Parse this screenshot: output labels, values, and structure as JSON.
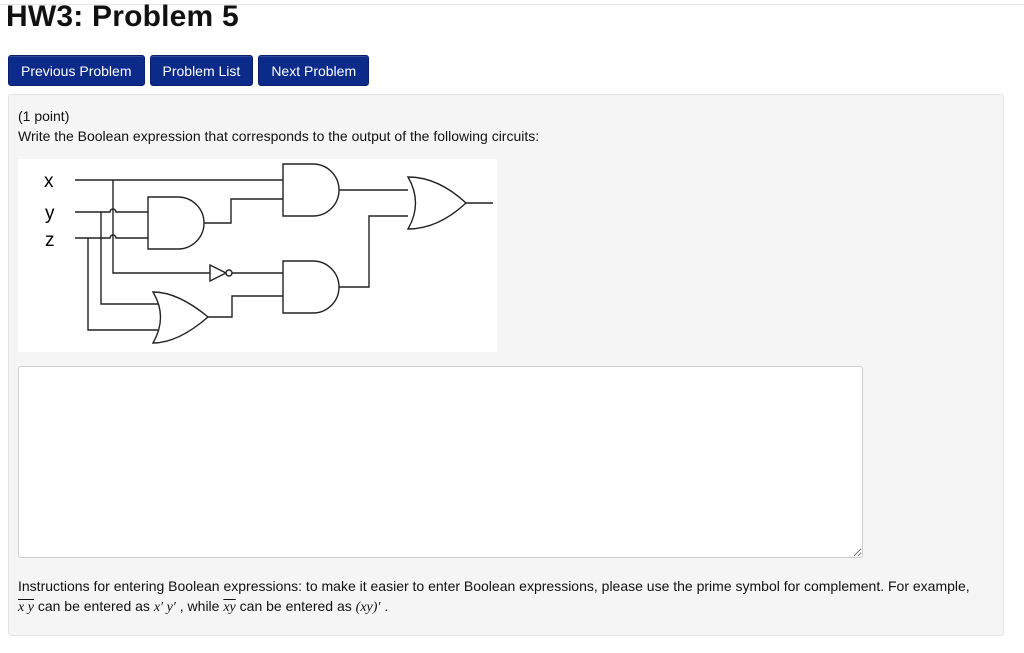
{
  "page": {
    "title": "HW3: Problem 5"
  },
  "nav": {
    "previous": "Previous Problem",
    "list": "Problem List",
    "next": "Next Problem"
  },
  "problem": {
    "points": "(1 point)",
    "prompt": "Write the Boolean expression that corresponds to the output of the following circuits:",
    "circuit": {
      "inputs": [
        "x",
        "y",
        "z"
      ]
    },
    "answer_value": "",
    "instructions": {
      "text": "Instructions for entering Boolean expressions: to make it easier to enter Boolean expressions, please use the prime symbol for complement. For example,",
      "ex1_overlined": "x y",
      "ex1_mid": " can be entered as ",
      "ex1_prime": "x′ y′",
      "ex1_join": " , while ",
      "ex2_overlined": "xy",
      "ex2_mid": " can be entered as ",
      "ex2_prime": "(xy)′",
      "end": " ."
    }
  }
}
